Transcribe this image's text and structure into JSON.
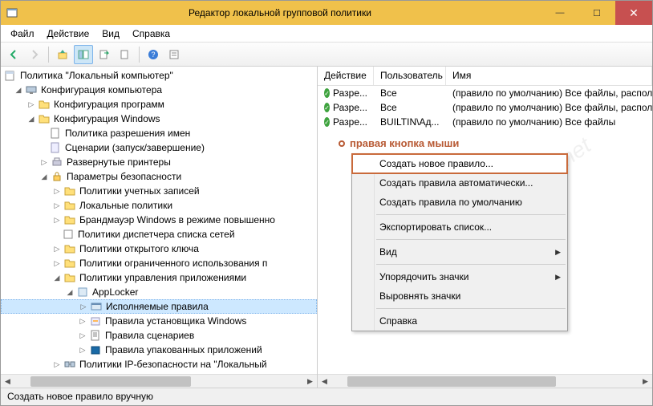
{
  "window": {
    "title": "Редактор локальной групповой политики"
  },
  "menubar": {
    "file": "Файл",
    "action": "Действие",
    "view": "Вид",
    "help": "Справка"
  },
  "tree": {
    "root": "Политика \"Локальный компьютер\"",
    "computer_config": "Конфигурация компьютера",
    "software_config": "Конфигурация программ",
    "windows_config": "Конфигурация Windows",
    "name_resolution": "Политика разрешения имен",
    "scripts": "Сценарии (запуск/завершение)",
    "deployed_printers": "Развернутые принтеры",
    "security_settings": "Параметры безопасности",
    "account_policies": "Политики учетных записей",
    "local_policies": "Локальные политики",
    "windows_firewall": "Брандмауэр Windows в режиме повышенно",
    "network_list": "Политики диспетчера списка сетей",
    "public_key": "Политики открытого ключа",
    "software_restriction": "Политики ограниченного использования п",
    "app_control": "Политики управления приложениями",
    "applocker": "AppLocker",
    "executable_rules": "Исполняемые правила",
    "installer_rules": "Правила установщика Windows",
    "script_rules": "Правила сценариев",
    "packaged_rules": "Правила упакованных приложений",
    "ip_security": "Политики IP-безопасности на \"Локальный"
  },
  "columns": {
    "action": "Действие",
    "user": "Пользователь",
    "name": "Имя"
  },
  "rows": [
    {
      "action": "Разре...",
      "user": "Все",
      "name": "(правило по умолчанию) Все файлы, располож"
    },
    {
      "action": "Разре...",
      "user": "Все",
      "name": "(правило по умолчанию) Все файлы, располож"
    },
    {
      "action": "Разре...",
      "user": "BUILTIN\\Ад...",
      "name": "(правило по умолчанию) Все файлы"
    }
  ],
  "annotation": "правая кнопка мыши",
  "context_menu": {
    "create_new_rule": "Создать новое правило...",
    "create_auto": "Создать правила автоматически...",
    "create_default": "Создать правила по умолчанию",
    "export_list": "Экспортировать список...",
    "view": "Вид",
    "arrange_icons": "Упорядочить значки",
    "align_icons": "Выровнять значки",
    "help": "Справка"
  },
  "statusbar": "Создать новое правило вручную",
  "watermark": "www.spy-soft.net"
}
